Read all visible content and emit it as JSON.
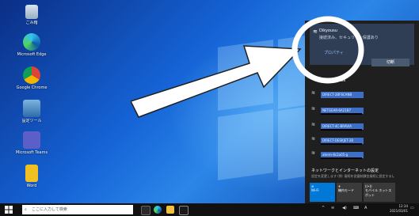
{
  "desktop": {
    "icons": [
      {
        "label": "ごみ箱",
        "icon": "recycle-bin-icon"
      },
      {
        "label": "Microsoft Edge",
        "icon": "edge-icon"
      },
      {
        "label": "Google Chrome",
        "icon": "chrome-icon"
      },
      {
        "label": "設定ツール",
        "icon": "settings-tool-icon"
      },
      {
        "label": "Microsoft Teams",
        "icon": "teams-icon"
      },
      {
        "label": "Word",
        "icon": "document-icon"
      }
    ]
  },
  "network_panel": {
    "connected": {
      "ssid": "Dikyousu",
      "status": "接続済み、セキュリティ保護あり",
      "properties_label": "プロパティ",
      "disconnect_label": "切断"
    },
    "networks": [
      {
        "name": "Buffalo-2CCB8"
      },
      {
        "name": "DIRECT-2BF6CANB"
      },
      {
        "name": "NETGEAR-6A21B7"
      },
      {
        "name": "DIRECT-4C-BRAVIA"
      },
      {
        "name": "DIRECT-DESKJET-2B"
      },
      {
        "name": "aterm-8c2a05-g"
      }
    ],
    "settings_title": "ネットワークとインターネットの設定",
    "settings_subtitle": "設定を変更します (例: 接続を従量制課金接続に設定する)。",
    "quick_tiles": [
      {
        "label": "Wi-Fi",
        "icon": "wifi-icon"
      },
      {
        "label": "機内モード",
        "icon": "airplane-icon"
      },
      {
        "label": "モバイル ホットスポット",
        "icon": "hotspot-icon"
      }
    ]
  },
  "taskbar": {
    "search_placeholder": "ここに入力して検索",
    "time": "12:34",
    "date": "2021/03/01",
    "ime": "A"
  },
  "colors": {
    "accent": "#0078d7",
    "panel_bg": "#1f1f1f",
    "connected_card": "#2f3e55",
    "highlight_circle": "#ffffff"
  }
}
